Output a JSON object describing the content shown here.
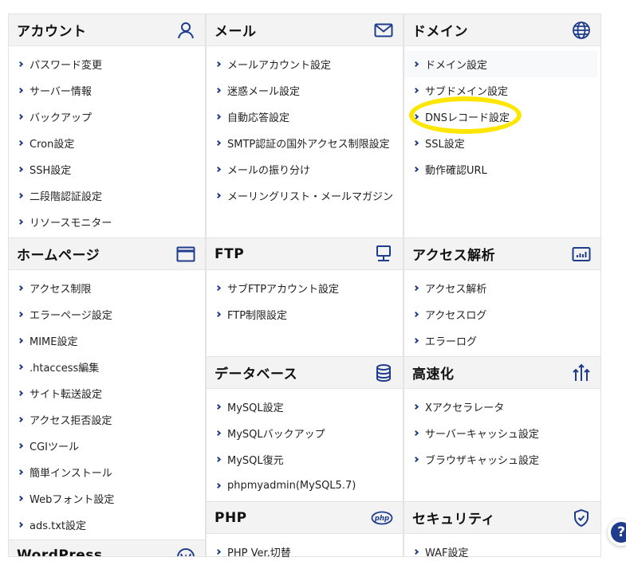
{
  "panels": {
    "account": {
      "title": "アカウント",
      "icon": "user-icon",
      "items": [
        "パスワード変更",
        "サーバー情報",
        "バックアップ",
        "Cron設定",
        "SSH設定",
        "二段階認証設定",
        "リソースモニター"
      ]
    },
    "mail": {
      "title": "メール",
      "icon": "mail-icon",
      "items": [
        "メールアカウント設定",
        "迷惑メール設定",
        "自動応答設定",
        "SMTP認証の国外アクセス制限設定",
        "メールの振り分け",
        "メーリングリスト・メールマガジン"
      ]
    },
    "domain": {
      "title": "ドメイン",
      "icon": "globe-icon",
      "items": [
        "ドメイン設定",
        "サブドメイン設定",
        "DNSレコード設定",
        "SSL設定",
        "動作確認URL"
      ]
    },
    "homepage": {
      "title": "ホームページ",
      "icon": "browser-window-icon",
      "items": [
        "アクセス制限",
        "エラーページ設定",
        "MIME設定",
        ".htaccess編集",
        "サイト転送設定",
        "アクセス拒否設定",
        "CGIツール",
        "簡単インストール",
        "Webフォント設定",
        "ads.txt設定"
      ]
    },
    "ftp": {
      "title": "FTP",
      "icon": "monitor-icon",
      "items": [
        "サブFTPアカウント設定",
        "FTP制限設定"
      ]
    },
    "access_analysis": {
      "title": "アクセス解析",
      "icon": "bar-chart-icon",
      "items": [
        "アクセス解析",
        "アクセスログ",
        "エラーログ"
      ]
    },
    "database": {
      "title": "データベース",
      "icon": "database-icon",
      "items": [
        "MySQL設定",
        "MySQLバックアップ",
        "MySQL復元",
        "phpmyadmin(MySQL5.7)"
      ]
    },
    "speedup": {
      "title": "高速化",
      "icon": "speed-arrows-icon",
      "items": [
        "Xアクセラレータ",
        "サーバーキャッシュ設定",
        "ブラウザキャッシュ設定"
      ]
    },
    "php": {
      "title": "PHP",
      "icon": "php-icon",
      "icon_text": "php",
      "items": [
        "PHP Ver.切替"
      ]
    },
    "security": {
      "title": "セキュリティ",
      "icon": "shield-check-icon",
      "items": [
        "WAF設定"
      ]
    },
    "wordpress": {
      "title": "WordPress",
      "icon": "wordpress-icon"
    }
  },
  "help": {
    "label": "?"
  },
  "colors": {
    "accent": "#1f3d8c",
    "header_bg": "#f3f3f3",
    "highlight": "#ffe600"
  }
}
